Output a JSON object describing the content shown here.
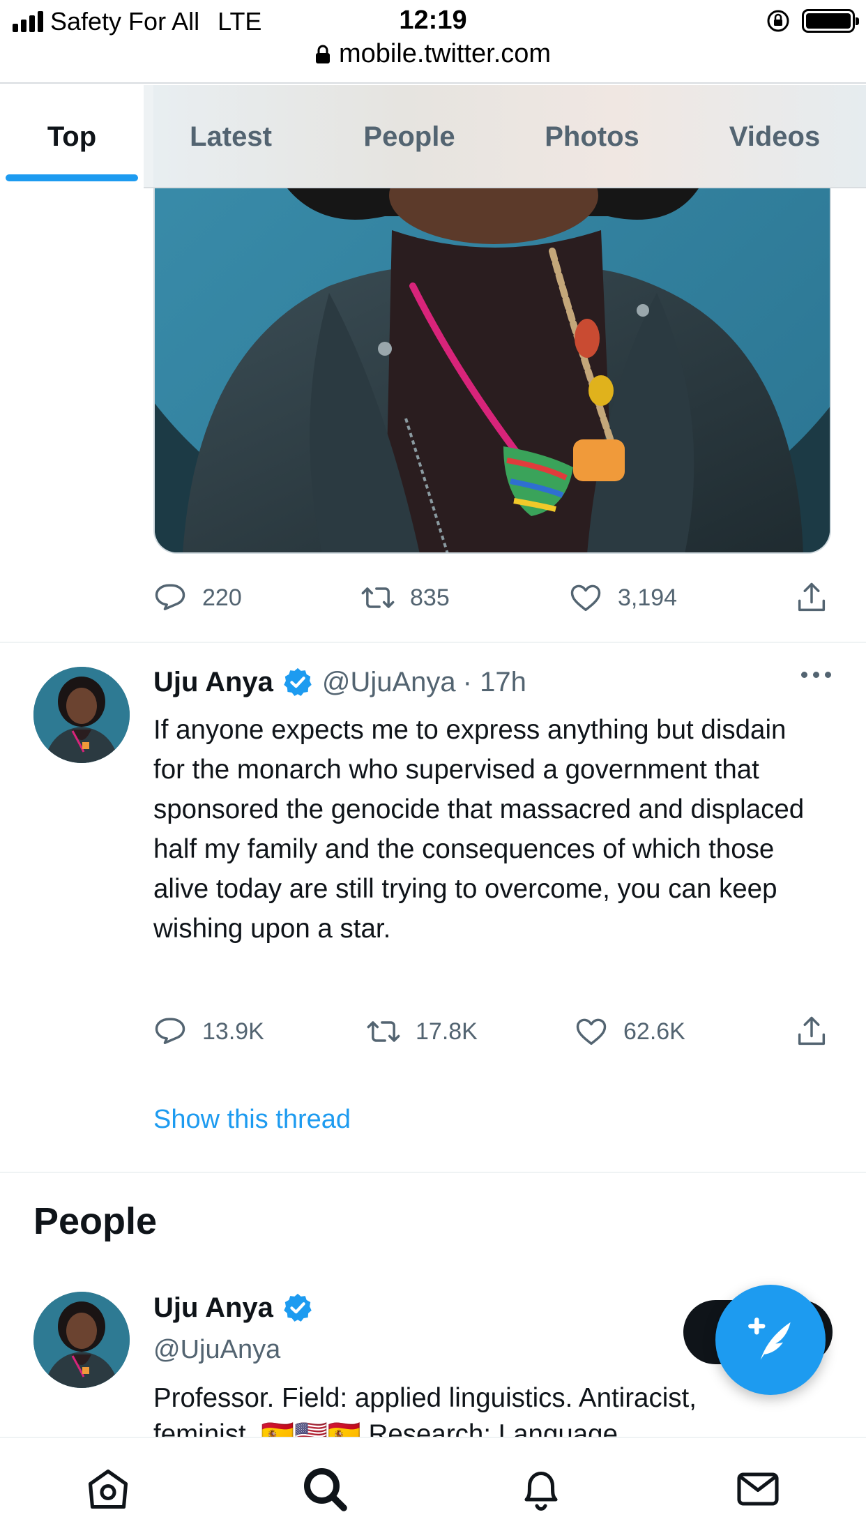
{
  "status_bar": {
    "carrier": "Safety For All",
    "network": "LTE",
    "time": "12:19",
    "url": "mobile.twitter.com"
  },
  "tabs": [
    {
      "label": "Top",
      "active": true
    },
    {
      "label": "Latest",
      "active": false
    },
    {
      "label": "People",
      "active": false
    },
    {
      "label": "Photos",
      "active": false
    },
    {
      "label": "Videos",
      "active": false
    }
  ],
  "previous_tweet": {
    "replies": "220",
    "retweets": "835",
    "likes": "3,194"
  },
  "tweet": {
    "name": "Uju Anya",
    "handle": "@UjuAnya",
    "time": "· 17h",
    "text": "If anyone expects me to express anything but disdain for the monarch who supervised a government that sponsored the genocide that massacred and displaced half my family and the consequences of which those alive today are still trying to overcome, you can keep wishing upon a star.",
    "replies": "13.9K",
    "retweets": "17.8K",
    "likes": "62.6K",
    "thread_link": "Show this thread"
  },
  "people_section": {
    "title": "People",
    "person": {
      "name": "Uju Anya",
      "handle": "@UjuAnya",
      "bio": "Professor. Field: applied linguistics. Antiracist,",
      "bio_cut": "feminist. 🇪🇸🇺🇸🇪🇸 Research: Language"
    }
  },
  "colors": {
    "accent": "#1d9bf0",
    "text": "#0f1419",
    "secondary": "#536471"
  },
  "icons": {
    "reply": "reply-icon",
    "retweet": "retweet-icon",
    "like": "heart-icon",
    "share": "share-icon",
    "verified": "verified-badge-icon",
    "compose": "compose-tweet-icon",
    "nav": [
      "home-icon",
      "search-icon",
      "notifications-icon",
      "messages-icon"
    ]
  }
}
